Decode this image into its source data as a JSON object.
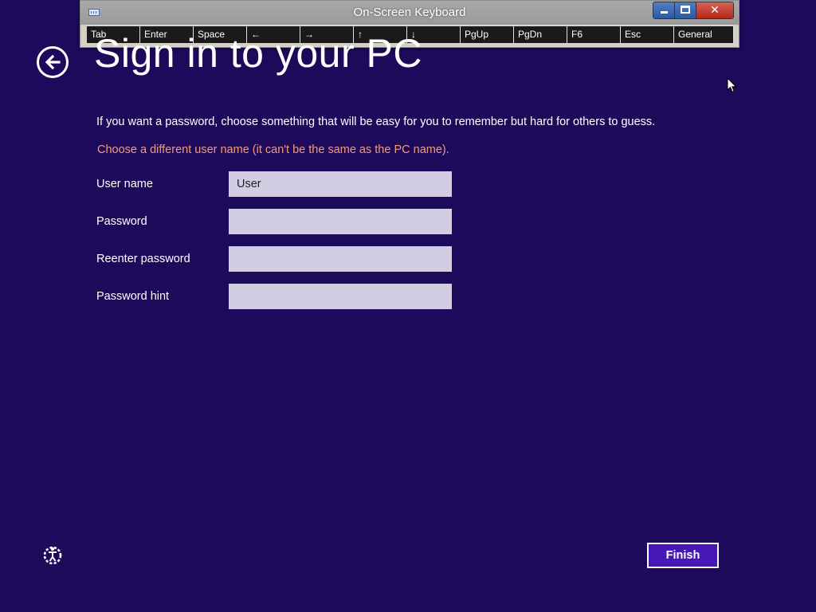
{
  "osk": {
    "title": "On-Screen Keyboard",
    "close_glyph": "✕",
    "keys": [
      "Tab",
      "Enter",
      "Space",
      "←",
      "→",
      "↑",
      "↓",
      "PgUp",
      "PgDn",
      "F6",
      "Esc",
      "General"
    ]
  },
  "header": {
    "title": "Sign in to your PC"
  },
  "main": {
    "intro": "If you want a password, choose something that will be easy for you to remember but hard for others to guess.",
    "error": "Choose a different user name (it can't be the same as the PC name).",
    "fields": {
      "username": {
        "label": "User name",
        "value": "User"
      },
      "password": {
        "label": "Password",
        "value": ""
      },
      "reenter": {
        "label": "Reenter password",
        "value": ""
      },
      "hint": {
        "label": "Password hint",
        "value": ""
      }
    }
  },
  "footer": {
    "finish_label": "Finish",
    "ease_of_access_icon": "ease-of-access-icon"
  },
  "colors": {
    "background": "#1e0a5a",
    "error": "#f39a7e",
    "input_bg": "#d1cde3",
    "finish_bg": "#4617b4"
  }
}
